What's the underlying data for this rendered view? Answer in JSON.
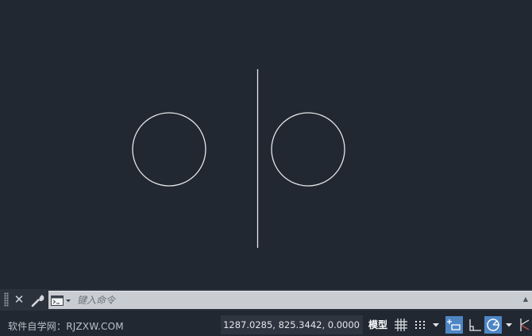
{
  "drawing": {
    "shapes": [
      {
        "kind": "circle",
        "name": "left-circle"
      },
      {
        "kind": "line",
        "name": "vertical-line"
      },
      {
        "kind": "circle",
        "name": "right-circle"
      }
    ],
    "line_color": "#e6e8ea",
    "background_color": "#212831"
  },
  "command_line": {
    "placeholder": "键入命令",
    "icons": [
      "grip-handle-icon",
      "close-icon",
      "wrench-icon",
      "command-prompt-icon",
      "chevron-down-icon",
      "scroll-up-icon"
    ]
  },
  "status_bar": {
    "brand_text": "软件自学网：RJZXW.COM",
    "coordinates": "1287.0285, 825.3442, 0.0000",
    "model_tab": "模型",
    "toggles": [
      {
        "name": "grid-display",
        "icon": "grid-icon",
        "active": false
      },
      {
        "name": "snap-mode",
        "icon": "snap-dots-icon",
        "active": false
      },
      {
        "name": "snap-menu",
        "icon": "chevron-down-icon",
        "active": false
      },
      {
        "name": "infer-constraints",
        "icon": "infer-constraints-icon",
        "active": true
      },
      {
        "name": "ortho-mode",
        "icon": "ortho-icon",
        "active": false
      },
      {
        "name": "polar-tracking",
        "icon": "polar-tracking-icon",
        "active": true
      },
      {
        "name": "polar-menu",
        "icon": "chevron-down-icon",
        "active": false
      },
      {
        "name": "isometric-drafting",
        "icon": "isodraft-icon",
        "active": false
      }
    ],
    "accent_color": "#4e86c4"
  }
}
